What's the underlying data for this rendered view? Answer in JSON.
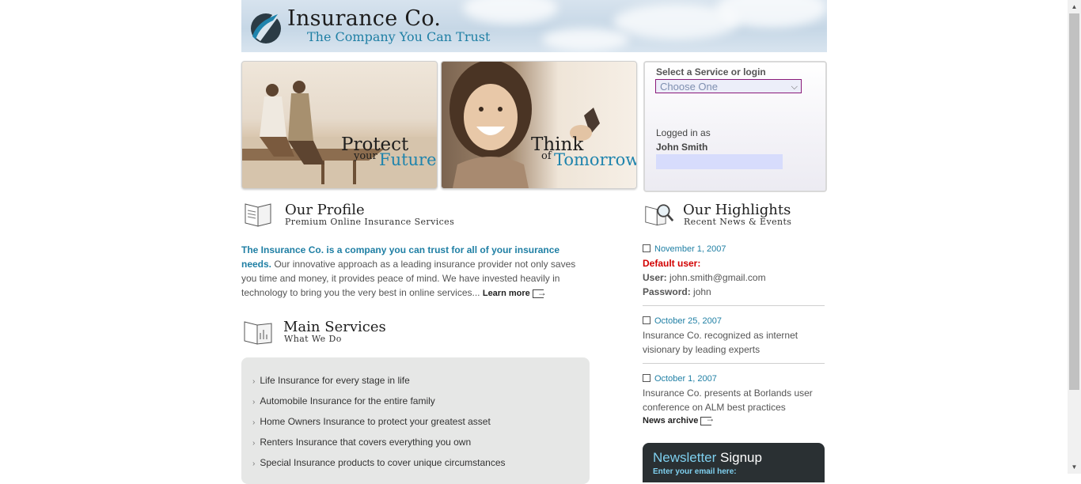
{
  "header": {
    "logo_title": "Insurance Co.",
    "logo_tagline": "The Company You Can Trust",
    "colors": {
      "accent": "#1f7fa4",
      "logo_dark": "#2b3b45"
    }
  },
  "banners": [
    {
      "title_main": "Protect",
      "title_small": "your",
      "title_accent": "Future"
    },
    {
      "title_main": "Think",
      "title_small": "of",
      "title_accent": "Tomorrow"
    }
  ],
  "login": {
    "title": "Select a Service or login",
    "select_value": "Choose One",
    "logged_in_label": "Logged in as",
    "username": "John Smith"
  },
  "profile": {
    "title": "Our Profile",
    "subtitle": "Premium Online Insurance Services",
    "lead": "The Insurance Co. is a company you can trust for all of your insurance needs.",
    "body": " Our innovative approach as a leading insurance provider not only saves you time and money, it provides peace of mind. We have invested heavily in technology to bring you the very best in online services... ",
    "learn_more": "Learn more"
  },
  "services": {
    "title": "Main Services",
    "subtitle": "What We Do",
    "items": [
      "Life Insurance for every stage in life",
      "Automobile Insurance for the entire family",
      "Home Owners Insurance to protect your greatest asset",
      "Renters Insurance that covers everything you own",
      "Special Insurance products to cover unique circumstances"
    ]
  },
  "highlights": {
    "title": "Our Highlights",
    "subtitle": "Recent News & Events",
    "news": [
      {
        "date": "November 1, 2007",
        "default_label": "Default user:",
        "user_label": "User:",
        "user_value": " john.smith@gmail.com",
        "password_label": "Password:",
        "password_value": " john"
      },
      {
        "date": "October 25, 2007",
        "text": "Insurance Co. recognized as internet visionary by leading experts"
      },
      {
        "date": "October 1, 2007",
        "text": "Insurance Co. presents at Borlands user conference on ALM best practices"
      }
    ],
    "archive": "News archive"
  },
  "newsletter": {
    "title_accent": "Newsletter",
    "title_rest": " Signup",
    "prompt": "Enter your email here:"
  }
}
